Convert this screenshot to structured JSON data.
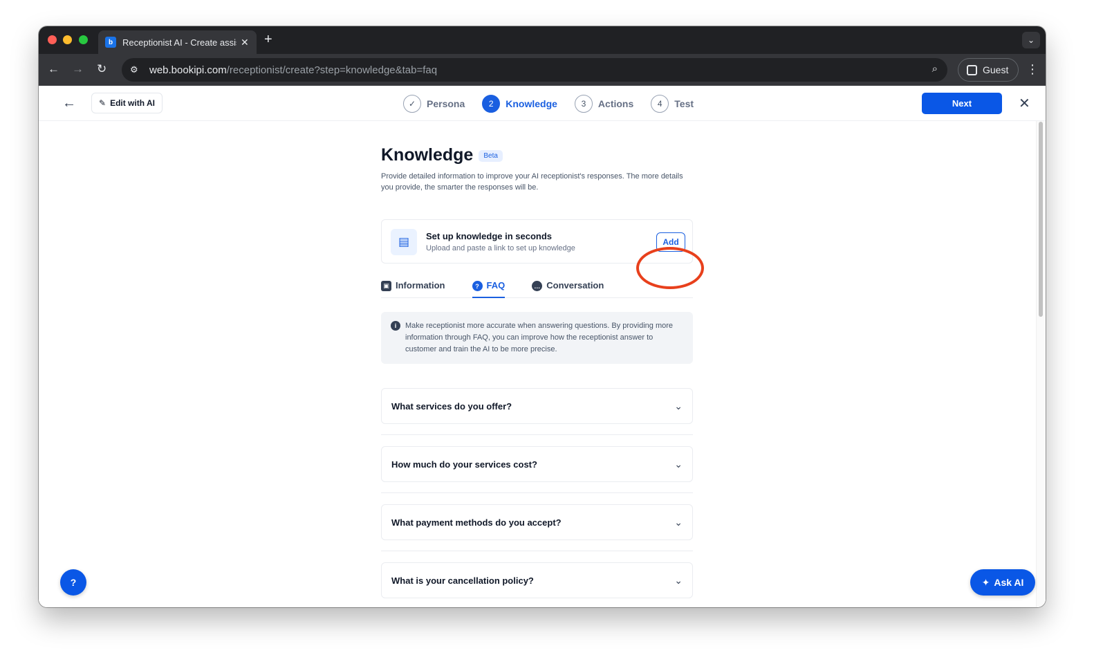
{
  "browser": {
    "tab_title": "Receptionist AI - Create assistant",
    "url_host": "web.bookipi.com",
    "url_path": "/receptionist/create?step=knowledge&tab=faq",
    "profile_label": "Guest"
  },
  "header": {
    "edit_ai_label": "Edit with AI",
    "steps": [
      {
        "num": "✓",
        "label": "Persona"
      },
      {
        "num": "2",
        "label": "Knowledge"
      },
      {
        "num": "3",
        "label": "Actions"
      },
      {
        "num": "4",
        "label": "Test"
      }
    ],
    "next_label": "Next"
  },
  "main": {
    "title": "Knowledge",
    "badge": "Beta",
    "description": "Provide detailed information to improve your AI receptionist's responses. The more details you provide, the smarter the responses will be.",
    "setup_card": {
      "title": "Set up knowledge in seconds",
      "subtitle": "Upload and paste a link to set up knowledge",
      "add_label": "Add"
    },
    "tabs": [
      {
        "label": "Information"
      },
      {
        "label": "FAQ"
      },
      {
        "label": "Conversation"
      }
    ],
    "info_text": "Make receptionist more accurate when answering questions. By providing more information through FAQ, you can improve how the receptionist answer to customer and train the AI to be more precise.",
    "faqs": [
      "What services do you offer?",
      "How much do your services cost?",
      "What payment methods do you accept?",
      "What is your cancellation policy?"
    ]
  },
  "fab": {
    "ask_ai_label": "Ask AI"
  },
  "colors": {
    "accent": "#0a57e6",
    "highlight": "#e8401c"
  }
}
